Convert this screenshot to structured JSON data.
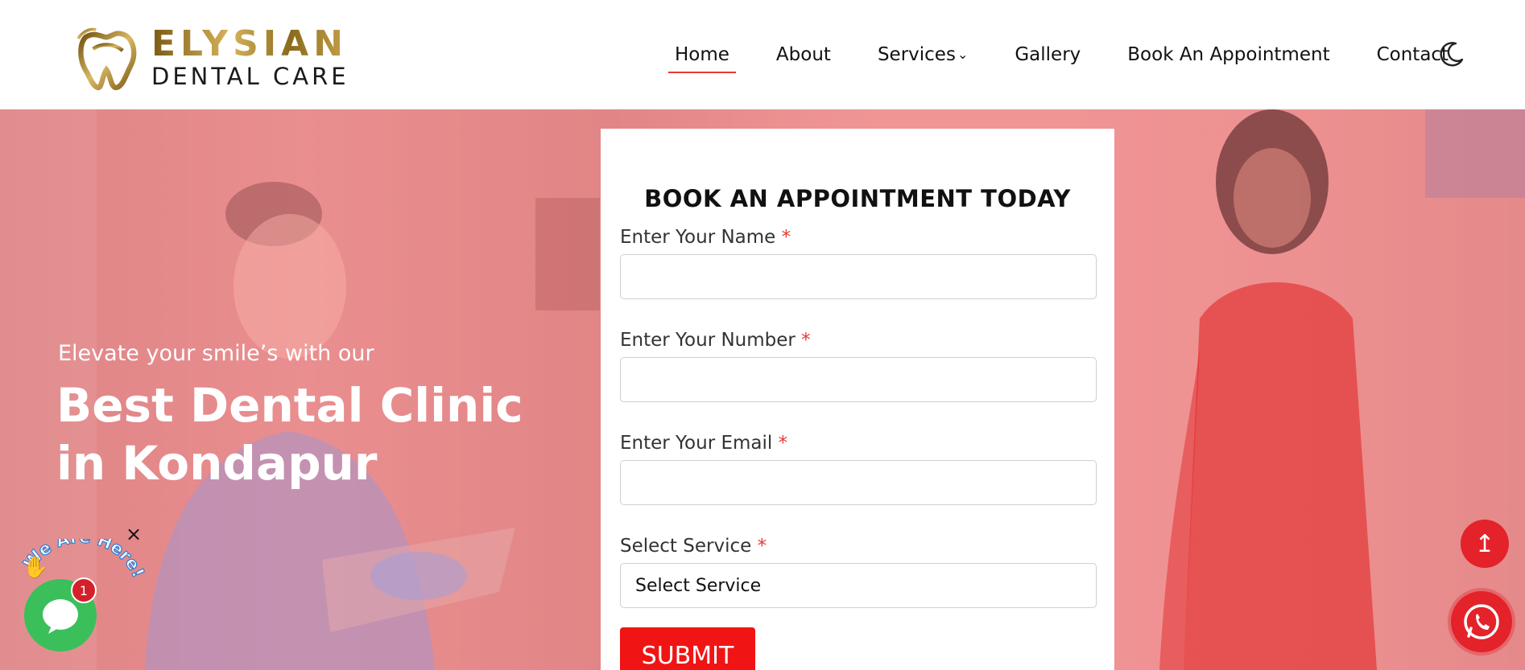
{
  "brand": {
    "name": "ELYSIAN",
    "tagline": "DENTAL CARE"
  },
  "nav": {
    "items": [
      {
        "label": "Home",
        "active": true
      },
      {
        "label": "About"
      },
      {
        "label": "Services",
        "has_dropdown": true
      },
      {
        "label": "Gallery"
      },
      {
        "label": "Book An Appointment"
      },
      {
        "label": "Contact"
      }
    ],
    "theme_toggle_icon": "moon-icon"
  },
  "hero": {
    "tagline": "Elevate your smile’s with our",
    "headline": "Best Dental Clinic in Kondapur"
  },
  "form": {
    "title": "BOOK AN APPOINTMENT TODAY",
    "fields": [
      {
        "label": "Enter Your Name",
        "required_mark": "*",
        "value": ""
      },
      {
        "label": "Enter Your Number",
        "required_mark": "*",
        "value": ""
      },
      {
        "label": "Enter Your Email",
        "required_mark": "*",
        "value": ""
      }
    ],
    "service": {
      "label": "Select Service",
      "required_mark": "*",
      "selected": "Select Service"
    },
    "submit_label": "SUBMIT"
  },
  "widget": {
    "text": "We Are Here!",
    "badge_count": "1",
    "close_glyph": "×"
  },
  "scroll_top_glyph": "↥",
  "colors": {
    "accent": "#e53935",
    "submit": "#f01414",
    "hero_overlay": "#f05050",
    "chat_green": "#3bbf5a",
    "brand_gold": "#b08a2e"
  }
}
